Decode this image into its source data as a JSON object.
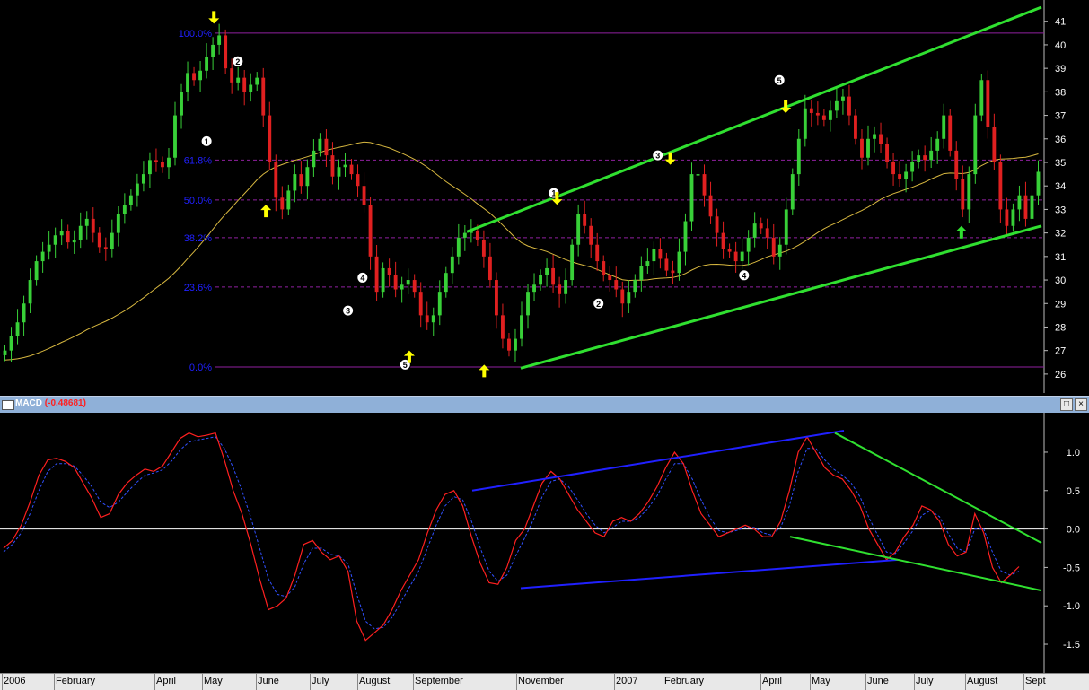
{
  "chart_data": [
    {
      "type": "candlestick",
      "ylim": [
        25.5,
        41.6
      ],
      "y_ticks": [
        26,
        27,
        28,
        29,
        30,
        31,
        32,
        33,
        34,
        35,
        36,
        37,
        38,
        39,
        40,
        41
      ],
      "fibonacci": [
        {
          "label": "100.0%",
          "value": 40.5
        },
        {
          "label": "61.8%",
          "value": 35.1
        },
        {
          "label": "50.0%",
          "value": 33.4
        },
        {
          "label": "38.2%",
          "value": 31.8
        },
        {
          "label": "23.6%",
          "value": 29.7
        },
        {
          "label": "0.0%",
          "value": 26.3
        }
      ],
      "wave_labels": [
        {
          "label": "1",
          "x": 0.197,
          "y": 35.9
        },
        {
          "label": "2",
          "x": 0.227,
          "y": 39.3
        },
        {
          "label": "3",
          "x": 0.333,
          "y": 28.7
        },
        {
          "label": "4",
          "x": 0.347,
          "y": 30.1
        },
        {
          "label": "5",
          "x": 0.388,
          "y": 26.4
        },
        {
          "label": "1",
          "x": 0.531,
          "y": 33.7
        },
        {
          "label": "2",
          "x": 0.574,
          "y": 29.0
        },
        {
          "label": "3",
          "x": 0.631,
          "y": 35.3
        },
        {
          "label": "4",
          "x": 0.714,
          "y": 30.2
        },
        {
          "label": "5",
          "x": 0.748,
          "y": 38.5
        }
      ],
      "signal_arrows": [
        {
          "dir": "down",
          "x": 0.204,
          "y": 40.9
        },
        {
          "dir": "up",
          "x": 0.254,
          "y": 33.2
        },
        {
          "dir": "up",
          "x": 0.392,
          "y": 27.0
        },
        {
          "dir": "up",
          "x": 0.464,
          "y": 26.4
        },
        {
          "dir": "down",
          "x": 0.534,
          "y": 33.2
        },
        {
          "dir": "down",
          "x": 0.643,
          "y": 34.9
        },
        {
          "dir": "down",
          "x": 0.754,
          "y": 37.1
        },
        {
          "dir": "up",
          "x": 0.923,
          "y": 32.3
        }
      ],
      "close": [
        27.0,
        27.6,
        28.2,
        29.0,
        30.0,
        30.8,
        31.2,
        31.5,
        31.9,
        32.1,
        31.6,
        31.7,
        32.3,
        32.6,
        32.0,
        31.4,
        31.3,
        32.0,
        32.8,
        33.2,
        33.6,
        34.1,
        34.5,
        35.1,
        35.0,
        34.8,
        35.2,
        37.0,
        38.0,
        38.8,
        38.5,
        38.9,
        39.5,
        40.0,
        40.4,
        39.0,
        38.4,
        38.6,
        38.0,
        38.3,
        38.6,
        37.0,
        35.0,
        33.5,
        33.0,
        33.8,
        34.5,
        34.0,
        34.8,
        35.5,
        36.0,
        35.3,
        34.4,
        34.8,
        34.9,
        34.5,
        34.0,
        33.2,
        31.0,
        29.5,
        30.5,
        30.2,
        29.6,
        29.8,
        30.0,
        29.5,
        28.5,
        28.2,
        28.5,
        29.5,
        30.3,
        31.0,
        31.8,
        32.0,
        32.1,
        31.7,
        31.0,
        30.0,
        28.5,
        27.5,
        27.0,
        27.5,
        28.5,
        29.5,
        29.8,
        30.2,
        30.5,
        29.8,
        29.4,
        30.0,
        31.5,
        32.8,
        32.3,
        31.5,
        30.8,
        30.2,
        30.0,
        29.6,
        29.0,
        29.5,
        30.0,
        30.6,
        30.8,
        31.3,
        30.9,
        30.4,
        30.3,
        31.2,
        32.5,
        34.5,
        34.5,
        33.6,
        32.7,
        32.0,
        31.3,
        31.2,
        30.8,
        31.2,
        31.8,
        32.4,
        32.2,
        31.8,
        31.0,
        31.5,
        33.0,
        34.5,
        36.0,
        37.3,
        37.1,
        37.0,
        36.8,
        37.2,
        37.6,
        37.8,
        37.0,
        36.0,
        35.2,
        36.0,
        36.2,
        35.8,
        35.0,
        34.5,
        34.3,
        34.6,
        35.0,
        35.3,
        35.1,
        35.5,
        36.0,
        37.0,
        35.5,
        34.3,
        33.0,
        34.5,
        37.0,
        38.5,
        36.5,
        35.0,
        33.0,
        32.3,
        33.0,
        33.6,
        32.6,
        33.6,
        34.6
      ]
    },
    {
      "type": "line",
      "title": "MACD",
      "value_label": "(-0.48681)",
      "ylim": [
        -1.78,
        1.42
      ],
      "y_ticks": [
        -1.5,
        -1.0,
        -0.5,
        0.0,
        0.5,
        1.0
      ],
      "y_tick_labels": [
        "-1.5",
        "-1.0",
        "-0.5",
        "0.0",
        "0.5",
        "1.0"
      ],
      "series": [
        {
          "values": [
            -0.25,
            -0.15,
            0.05,
            0.35,
            0.7,
            0.9,
            0.92,
            0.88,
            0.8,
            0.6,
            0.4,
            0.15,
            0.2,
            0.45,
            0.6,
            0.7,
            0.78,
            0.75,
            0.82,
            1.0,
            1.18,
            1.25,
            1.2,
            1.22,
            1.25,
            0.9,
            0.5,
            0.2,
            -0.2,
            -0.65,
            -1.05,
            -1.0,
            -0.9,
            -0.6,
            -0.2,
            -0.15,
            -0.3,
            -0.4,
            -0.35,
            -0.55,
            -1.2,
            -1.45,
            -1.35,
            -1.25,
            -1.05,
            -0.8,
            -0.6,
            -0.4,
            -0.05,
            0.25,
            0.45,
            0.5,
            0.3,
            -0.1,
            -0.45,
            -0.7,
            -0.72,
            -0.5,
            -0.15,
            0.0,
            0.3,
            0.6,
            0.75,
            0.65,
            0.45,
            0.25,
            0.1,
            -0.05,
            -0.1,
            0.1,
            0.15,
            0.1,
            0.2,
            0.35,
            0.55,
            0.8,
            1.0,
            0.85,
            0.5,
            0.2,
            0.05,
            -0.1,
            -0.05,
            0.0,
            0.05,
            0.0,
            -0.1,
            -0.1,
            0.1,
            0.5,
            1.0,
            1.2,
            1.0,
            0.8,
            0.7,
            0.65,
            0.5,
            0.3,
            0.0,
            -0.2,
            -0.4,
            -0.3,
            -0.1,
            0.05,
            0.3,
            0.25,
            0.1,
            -0.2,
            -0.35,
            -0.3,
            0.2,
            -0.05,
            -0.5,
            -0.7,
            -0.6,
            -0.49
          ]
        },
        {
          "values": [
            -0.3,
            -0.2,
            -0.05,
            0.2,
            0.5,
            0.75,
            0.85,
            0.85,
            0.82,
            0.7,
            0.55,
            0.35,
            0.28,
            0.35,
            0.48,
            0.6,
            0.7,
            0.73,
            0.77,
            0.88,
            1.03,
            1.13,
            1.16,
            1.18,
            1.2,
            1.05,
            0.8,
            0.5,
            0.15,
            -0.25,
            -0.65,
            -0.85,
            -0.88,
            -0.75,
            -0.45,
            -0.25,
            -0.25,
            -0.33,
            -0.35,
            -0.45,
            -0.85,
            -1.2,
            -1.3,
            -1.28,
            -1.15,
            -0.95,
            -0.75,
            -0.55,
            -0.25,
            0.05,
            0.3,
            0.42,
            0.38,
            0.1,
            -0.25,
            -0.55,
            -0.68,
            -0.6,
            -0.35,
            -0.12,
            0.12,
            0.42,
            0.62,
            0.65,
            0.55,
            0.38,
            0.2,
            0.05,
            -0.05,
            0.02,
            0.1,
            0.1,
            0.15,
            0.27,
            0.43,
            0.65,
            0.85,
            0.85,
            0.65,
            0.38,
            0.15,
            -0.02,
            -0.05,
            -0.02,
            0.02,
            0.02,
            -0.05,
            -0.08,
            0.02,
            0.3,
            0.75,
            1.05,
            1.05,
            0.9,
            0.78,
            0.7,
            0.6,
            0.42,
            0.15,
            -0.08,
            -0.3,
            -0.32,
            -0.18,
            -0.02,
            0.18,
            0.24,
            0.16,
            -0.06,
            -0.25,
            -0.3,
            0.0,
            0.0,
            -0.3,
            -0.55,
            -0.6,
            -0.55
          ]
        }
      ]
    }
  ],
  "x_axis": {
    "labels": [
      "2006",
      "February",
      "April",
      "May",
      "June",
      "July",
      "August",
      "September",
      "November",
      "2007",
      "February",
      "April",
      "May",
      "June",
      "July",
      "August",
      "Sept"
    ]
  },
  "macd_header": {
    "name": "MACD",
    "value": "(-0.48681)",
    "btn_restore": "□",
    "btn_close": "×"
  },
  "colors": {
    "background": "#000000",
    "up_candle": "#38d038",
    "down_candle": "#e02020",
    "fib_line": "#9020a0",
    "fib_label": "#2020ff",
    "channel": "#30e030",
    "moving_average": "#d8b840",
    "signal_arrow_yellow": "#ffff00",
    "signal_arrow_green": "#30e030",
    "macd_line": "#ff2020",
    "macd_signal": "#3050ff",
    "macd_trend_blue": "#2020ff",
    "macd_trend_green": "#30e030",
    "header_bar": "#8fb0d8"
  }
}
